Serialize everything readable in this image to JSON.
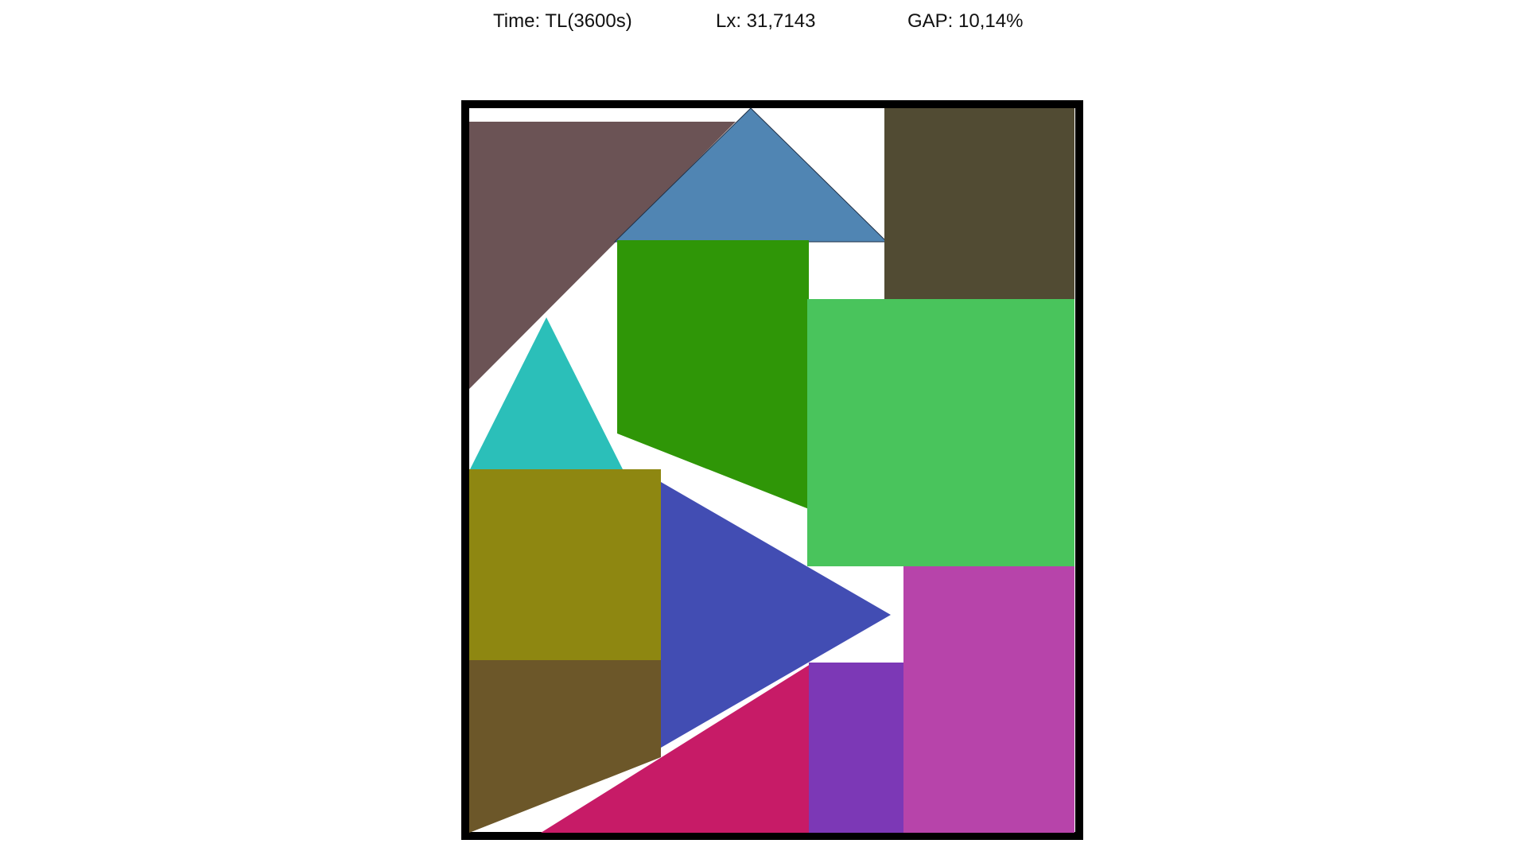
{
  "header": {
    "time_label": "Time: TL(3600s)",
    "lx_label": "Lx: 31,7143",
    "gap_label": "GAP: 10,14%"
  },
  "container": {
    "border_color": "#000000",
    "fill_color": "#ffffff"
  },
  "pieces": [
    {
      "id": "brown-gray-triangle",
      "shape": "triangle",
      "color": "#6b5355"
    },
    {
      "id": "steel-blue-triangle",
      "shape": "triangle",
      "color": "#5085b3"
    },
    {
      "id": "dark-olive-rectangle",
      "shape": "rectangle",
      "color": "#514b33"
    },
    {
      "id": "dark-green-trapezoid",
      "shape": "trapezoid",
      "color": "#2f9607"
    },
    {
      "id": "light-green-rectangle",
      "shape": "rectangle",
      "color": "#49c45c"
    },
    {
      "id": "teal-triangle",
      "shape": "triangle",
      "color": "#2bbfb9"
    },
    {
      "id": "olive-square",
      "shape": "rectangle",
      "color": "#8e8711"
    },
    {
      "id": "indigo-triangle",
      "shape": "triangle",
      "color": "#424db3"
    },
    {
      "id": "brown-trapezoid",
      "shape": "trapezoid",
      "color": "#6c5729"
    },
    {
      "id": "crimson-triangle",
      "shape": "triangle",
      "color": "#c71b67"
    },
    {
      "id": "purple-rectangle",
      "shape": "rectangle",
      "color": "#7c38b6"
    },
    {
      "id": "magenta-rectangle",
      "shape": "rectangle",
      "color": "#b744aa"
    }
  ]
}
